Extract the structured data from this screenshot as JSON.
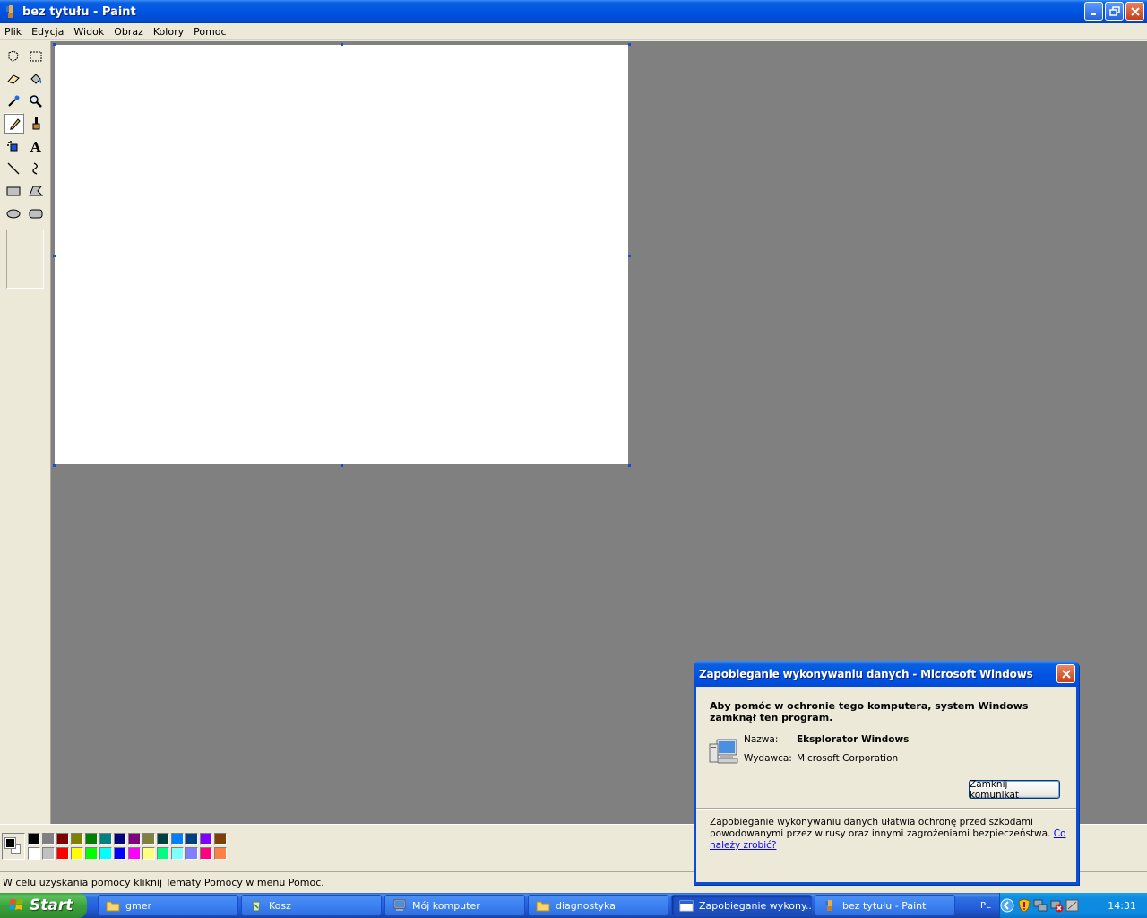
{
  "window": {
    "title": "bez tytułu - Paint"
  },
  "menu": {
    "items": [
      "Plik",
      "Edycja",
      "Widok",
      "Obraz",
      "Kolory",
      "Pomoc"
    ]
  },
  "toolbox": {
    "tools": [
      {
        "name": "free-form-select",
        "icon": "free-form-select-icon"
      },
      {
        "name": "rect-select",
        "icon": "rect-select-icon"
      },
      {
        "name": "eraser",
        "icon": "eraser-icon"
      },
      {
        "name": "fill",
        "icon": "fill-bucket-icon"
      },
      {
        "name": "pick-color",
        "icon": "eyedropper-icon"
      },
      {
        "name": "magnifier",
        "icon": "magnifier-icon"
      },
      {
        "name": "pencil",
        "icon": "pencil-icon",
        "active": true
      },
      {
        "name": "brush",
        "icon": "brush-icon"
      },
      {
        "name": "airbrush",
        "icon": "airbrush-icon"
      },
      {
        "name": "text",
        "icon": "text-icon"
      },
      {
        "name": "line",
        "icon": "line-icon"
      },
      {
        "name": "curve",
        "icon": "curve-icon"
      },
      {
        "name": "rectangle",
        "icon": "rectangle-icon"
      },
      {
        "name": "polygon",
        "icon": "polygon-icon"
      },
      {
        "name": "ellipse",
        "icon": "ellipse-icon"
      },
      {
        "name": "rounded-rectangle",
        "icon": "rounded-rectangle-icon"
      }
    ]
  },
  "palette": {
    "foreground": "#000000",
    "background": "#ffffff",
    "top_row": [
      "#000000",
      "#808080",
      "#800000",
      "#808000",
      "#008000",
      "#008080",
      "#000080",
      "#800080",
      "#808040",
      "#004040",
      "#0080ff",
      "#004080",
      "#8000ff",
      "#804000"
    ],
    "bottom_row": [
      "#ffffff",
      "#c0c0c0",
      "#ff0000",
      "#ffff00",
      "#00ff00",
      "#00ffff",
      "#0000ff",
      "#ff00ff",
      "#ffff80",
      "#00ff80",
      "#80ffff",
      "#8080ff",
      "#ff0080",
      "#ff8040"
    ]
  },
  "status": {
    "text": "W celu uzyskania pomocy kliknij Tematy Pomocy w menu Pomoc."
  },
  "dialog": {
    "title": "Zapobieganie wykonywaniu danych - Microsoft Windows",
    "heading": "Aby pomóc w ochronie tego komputera, system Windows zamknął ten program.",
    "name_label": "Nazwa:",
    "name_value": "Eksplorator Windows",
    "publisher_label": "Wydawca:",
    "publisher_value": "Microsoft Corporation",
    "close_button": "Zamknij komunikat",
    "footer_text": "Zapobieganie wykonywaniu danych ułatwia ochronę przed szkodami powodowanymi przez wirusy oraz innymi zagrożeniami bezpieczeństwa.",
    "footer_link": "Co należy zrobić?"
  },
  "taskbar": {
    "start_label": "Start",
    "tasks": [
      {
        "label": "gmer",
        "icon": "folder-icon"
      },
      {
        "label": "Kosz",
        "icon": "recycle-bin-icon"
      },
      {
        "label": "Mój komputer",
        "icon": "my-computer-icon"
      },
      {
        "label": "diagnostyka",
        "icon": "folder-icon"
      },
      {
        "label": "Zapobieganie wykony...",
        "icon": "window-icon",
        "active": true
      },
      {
        "label": "bez tytułu - Paint",
        "icon": "paint-icon"
      }
    ],
    "language": "PL",
    "clock": "14:31"
  },
  "colors": {
    "title_blue": "#0054e3",
    "workspace_gray": "#808080",
    "chrome": "#ece9d8",
    "start_green": "#3ca33c"
  }
}
